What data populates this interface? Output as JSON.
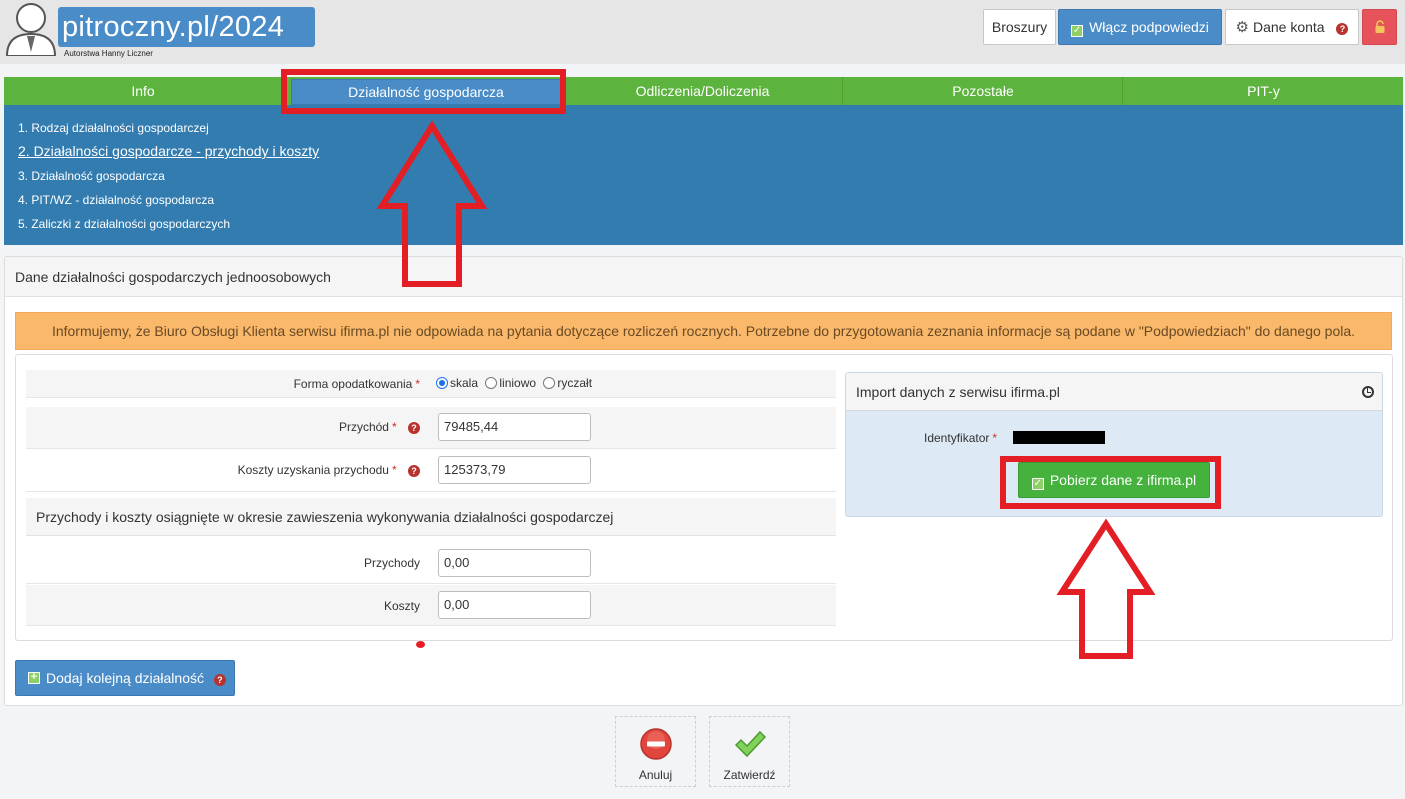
{
  "header": {
    "logo_text": "pitroczny.pl/2024",
    "logo_subtitle": "Autorstwa Hanny Liczner",
    "buttons": {
      "broszury": "Broszury",
      "podpowiedzi": "Włącz podpowiedzi",
      "dane_konta": "Dane konta"
    },
    "icons": [
      "avatar-icon",
      "checkbox-icon",
      "gear-icon",
      "help-icon",
      "lock-icon"
    ]
  },
  "nav": {
    "tabs": [
      {
        "label": "Info"
      },
      {
        "label": "Działalność gospodarcza",
        "active": true
      },
      {
        "label": "Odliczenia/Doliczenia"
      },
      {
        "label": "Pozostałe"
      },
      {
        "label": "PIT-y"
      }
    ],
    "subitems": [
      {
        "label": "1. Rodzaj działalności gospodarczej"
      },
      {
        "label": "2. Działalności gospodarcze - przychody i koszty",
        "current": true
      },
      {
        "label": "3. Działalność gospodarcza"
      },
      {
        "label": "4. PIT/WZ - działalność gospodarcza"
      },
      {
        "label": "5. Zaliczki z działalności gospodarczych"
      }
    ]
  },
  "panel": {
    "title": "Dane działalności gospodarczych jednoosobowych",
    "alert": "Informujemy, że Biuro Obsługi Klienta serwisu ifirma.pl nie odpowiada na pytania dotyczące rozliczeń rocznych. Potrzebne do przygotowania zeznania informacje są podane w \"Podpowiedziach\" do danego pola.",
    "form": {
      "forma_label": "Forma opodatkowania",
      "forma_options": [
        "skala",
        "liniowo",
        "ryczałt"
      ],
      "forma_selected": "skala",
      "przychod_label": "Przychód",
      "przychod_value": "79485,44",
      "koszty_label": "Koszty uzyskania przychodu",
      "koszty_value": "125373,79",
      "suspension_title": "Przychody i koszty osiągnięte w okresie zawieszenia wykonywania działalności gospodarczej",
      "przychody_label": "Przychody",
      "przychody_value": "0,00",
      "koszty2_label": "Koszty",
      "koszty2_value": "0,00",
      "required_mark": "*"
    },
    "import": {
      "title": "Import danych z serwisu ifirma.pl",
      "ident_label": "Identyfikator",
      "button": "Pobierz dane z ifirma.pl"
    },
    "add_button": "Dodaj kolejną działalność"
  },
  "footer": {
    "cancel": "Anuluj",
    "confirm": "Zatwierdź"
  },
  "colors": {
    "nav_green": "#5cb43e",
    "accent_blue": "#4a8cc7",
    "subnav_blue": "#337cb0",
    "alert_orange": "#f9b86a",
    "annotation_red": "#e31e25"
  }
}
